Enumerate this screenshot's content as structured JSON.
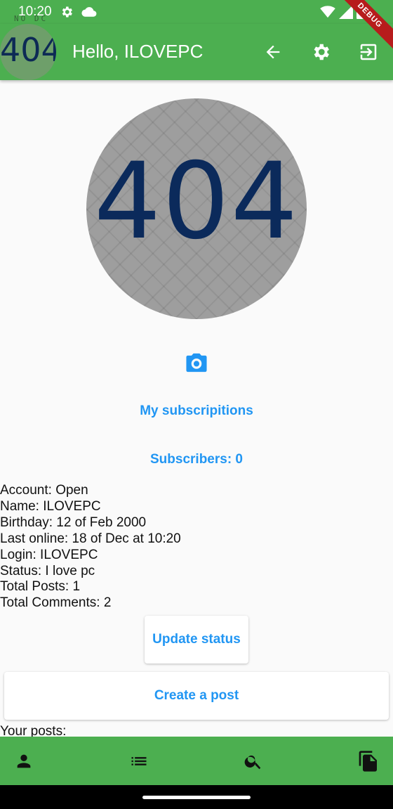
{
  "status_bar": {
    "time": "10:20",
    "overlay_text": "NO DC",
    "debug_label": "DEBUG"
  },
  "app_bar": {
    "avatar_text": "404",
    "title": "Hello, ILOVEPC"
  },
  "profile": {
    "avatar_text": "404",
    "my_subscriptions_label": "My subscripitions",
    "subscribers_label": "Subscribers: 0"
  },
  "info": {
    "account": "Account: Open",
    "name": "Name: ILOVEPC",
    "birthday": "Birthday: 12 of Feb 2000",
    "last_online": "Last online: 18 of Dec at 10:20",
    "login": "Login: ILOVEPC",
    "status": "Status: I love pc",
    "total_posts": "Total Posts: 1",
    "total_comments": "Total Comments: 2"
  },
  "actions": {
    "update_status_label": "Update status",
    "create_post_label": "Create a post"
  },
  "your_posts_label": "Your posts:",
  "icons": {
    "status": [
      "gear-icon",
      "cloud-icon",
      "wifi-icon",
      "signal-icon",
      "battery-icon"
    ],
    "app_bar": [
      "back-arrow-icon",
      "settings-icon",
      "exit-icon"
    ],
    "bottom_nav": [
      "person-icon",
      "list-icon",
      "search-icon",
      "documents-icon"
    ]
  },
  "colors": {
    "primary": "#4caf50",
    "accent": "#2196f3",
    "avatar_text": "#0b2a5b"
  }
}
